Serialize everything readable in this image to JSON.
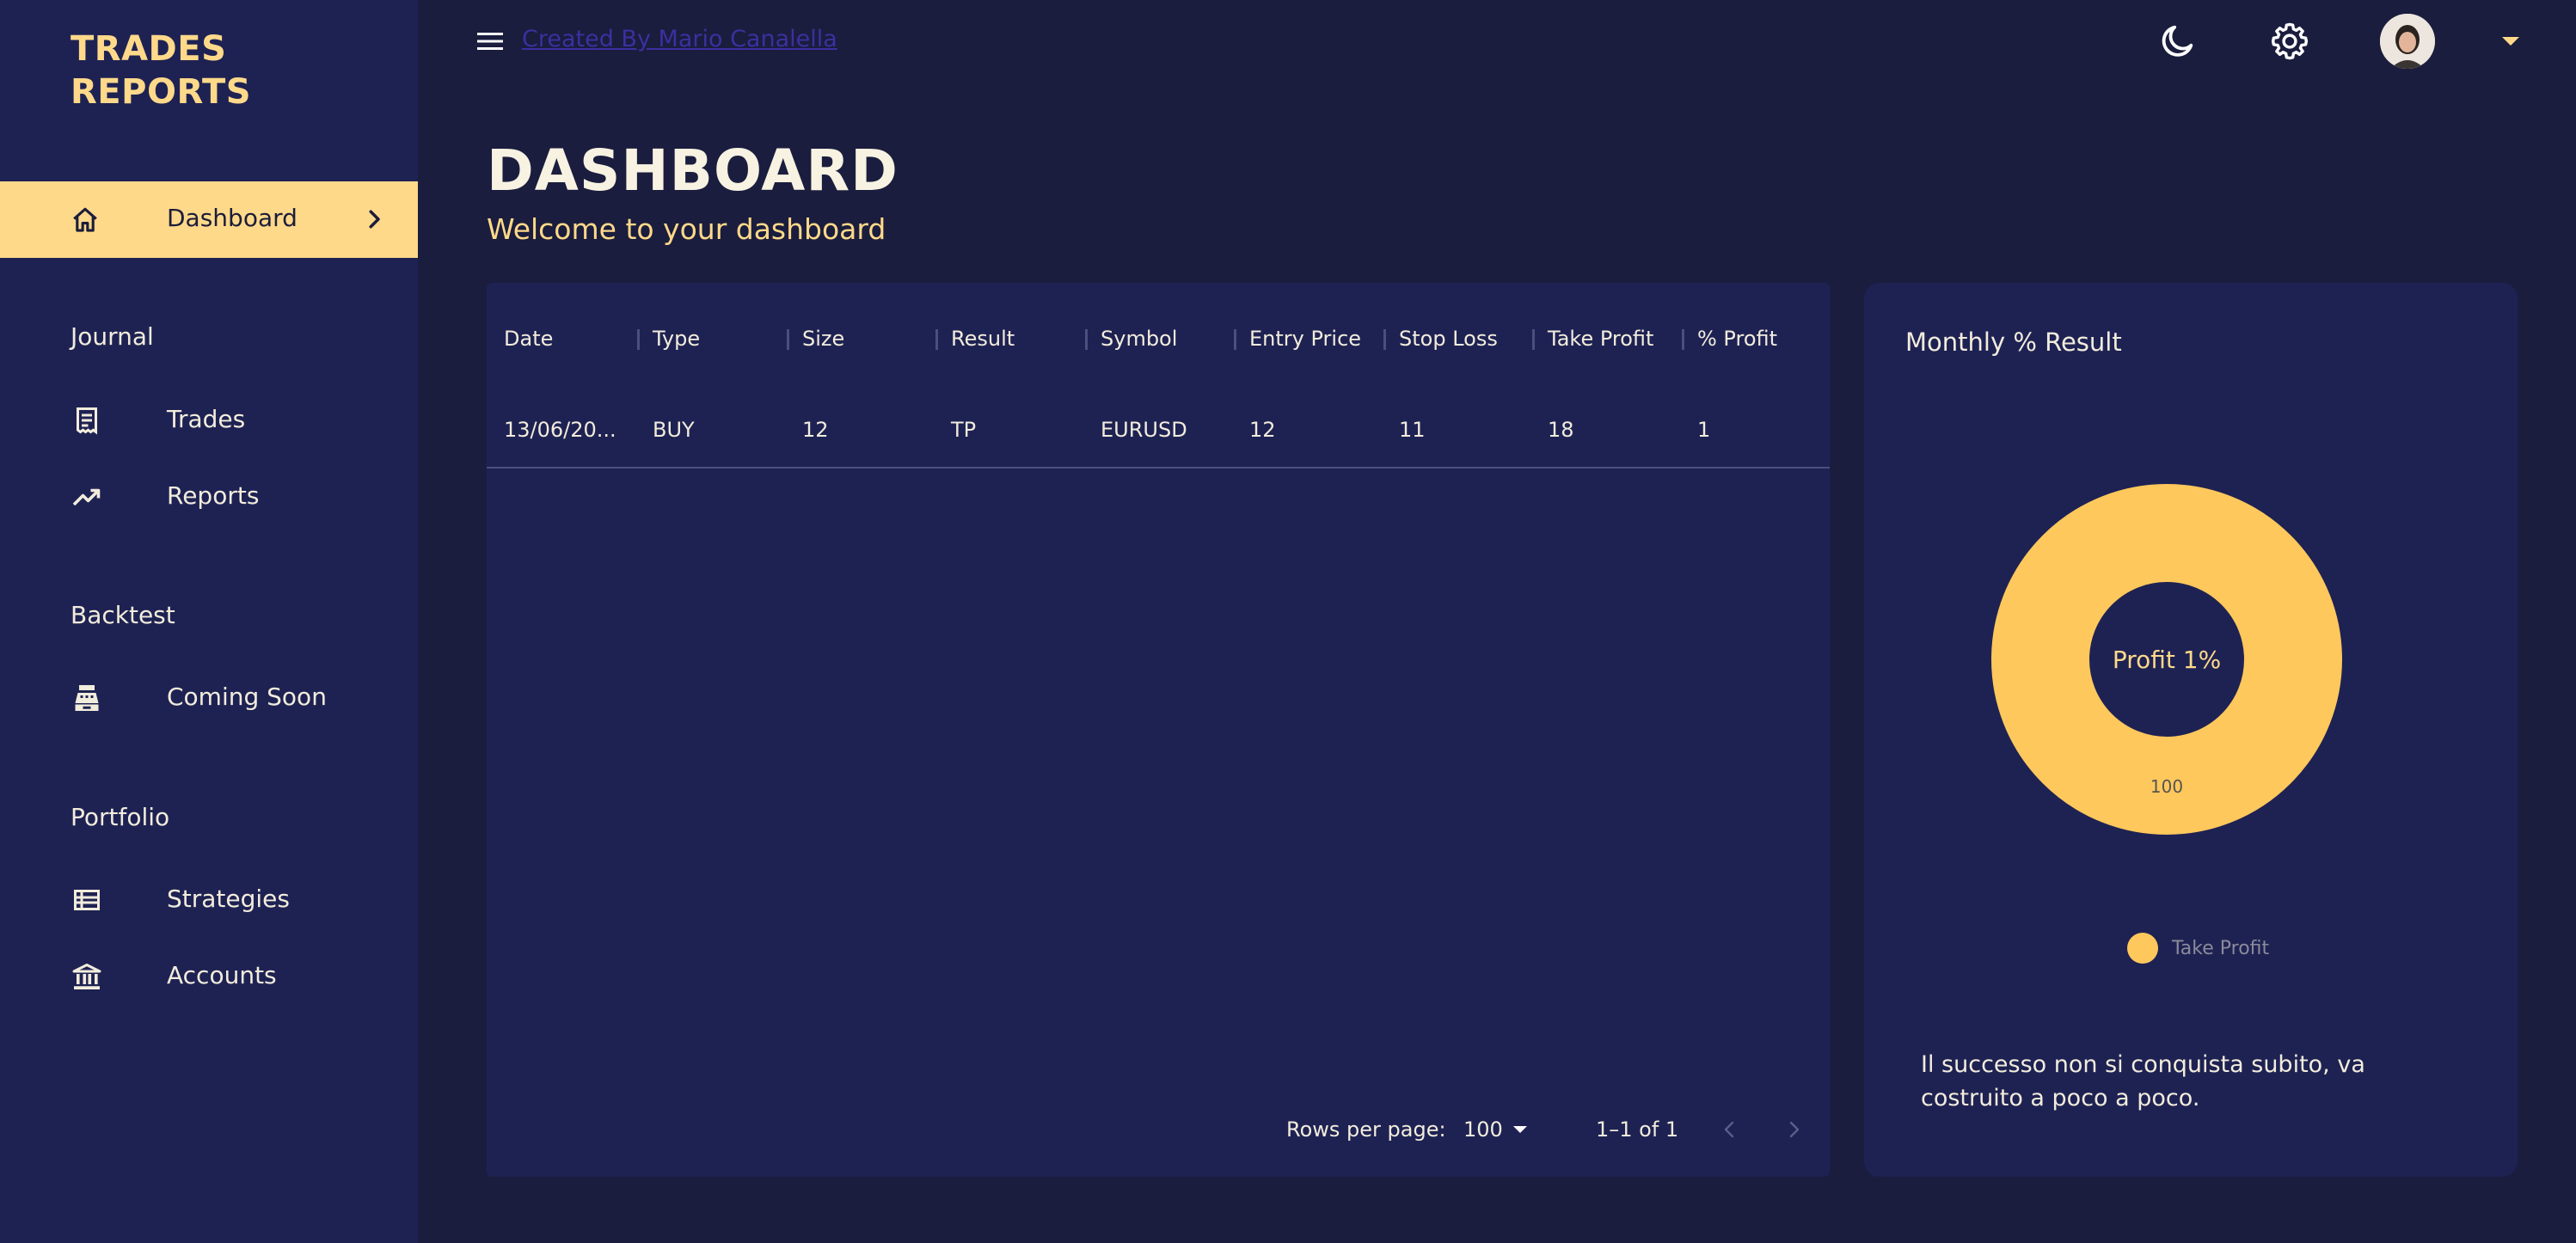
{
  "brand": {
    "line1": "TRADES",
    "line2": "REPORTS"
  },
  "nav": {
    "active": {
      "label": "Dashboard",
      "icon": "home-icon"
    },
    "sections": [
      {
        "title": "Journal",
        "items": [
          {
            "label": "Trades",
            "icon": "receipt-icon"
          },
          {
            "label": "Reports",
            "icon": "trending-up-icon"
          }
        ]
      },
      {
        "title": "Backtest",
        "items": [
          {
            "label": "Coming Soon",
            "icon": "cash-register-icon"
          }
        ]
      },
      {
        "title": "Portfolio",
        "items": [
          {
            "label": "Strategies",
            "icon": "list-icon"
          },
          {
            "label": "Accounts",
            "icon": "bank-icon"
          }
        ]
      }
    ]
  },
  "topbar": {
    "creator_link": "Created By Mario Canalella",
    "icons": [
      "menu-icon",
      "moon-icon",
      "gear-icon",
      "avatar",
      "caret-down-icon"
    ]
  },
  "header": {
    "title": "DASHBOARD",
    "subtitle": "Welcome to your dashboard"
  },
  "table": {
    "columns": [
      "Date",
      "Type",
      "Size",
      "Result",
      "Symbol",
      "Entry Price",
      "Stop Loss",
      "Take Profit",
      "% Profit"
    ],
    "rows": [
      [
        "13/06/20...",
        "BUY",
        "12",
        "TP",
        "EURUSD",
        "12",
        "11",
        "18",
        "1"
      ]
    ],
    "pagination": {
      "rows_per_page_label": "Rows per page:",
      "rows_per_page": "100",
      "range": "1–1 of 1"
    }
  },
  "chart": {
    "title": "Monthly % Result",
    "center_label": "Profit 1%",
    "quote": "Il successo non si conquista subito, va costruito a poco a poco."
  },
  "chart_data": {
    "type": "pie",
    "categories": [
      "Take Profit"
    ],
    "values": [
      100
    ],
    "data_labels": [
      "100"
    ],
    "colors": [
      "#ffc85c"
    ],
    "legend_position": "bottom"
  },
  "colors": {
    "background": "#1a1d3d",
    "panel": "#1e2253",
    "accent": "#ffd98a",
    "donut": "#ffc85c"
  }
}
